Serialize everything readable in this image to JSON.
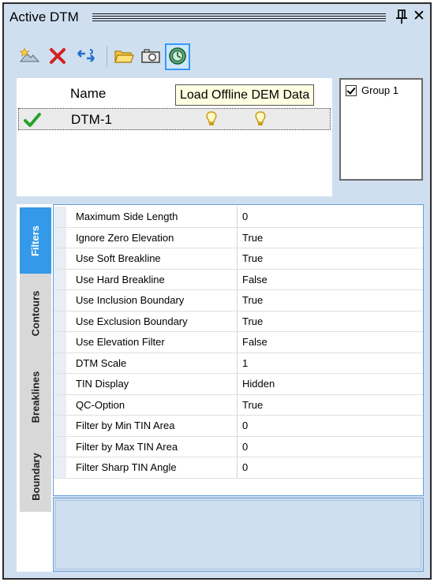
{
  "window": {
    "title": "Active DTM",
    "pin_icon": "pin-icon",
    "close_label": "✕"
  },
  "toolbar": {
    "buttons": [
      {
        "name": "new-dtm-icon"
      },
      {
        "name": "delete-icon"
      },
      {
        "name": "refresh-icon"
      },
      {
        "name": "open-folder-icon"
      },
      {
        "name": "camera-icon"
      },
      {
        "name": "globe-icon",
        "active": true
      }
    ],
    "tooltip": "Load Offline DEM Data"
  },
  "dtm_list": {
    "column_name": "Name",
    "rows": [
      {
        "name": "DTM-1",
        "checked": true
      }
    ]
  },
  "groups": {
    "items": [
      {
        "label": "Group 1",
        "checked": true
      }
    ]
  },
  "side_tabs": [
    "Filters",
    "Contours",
    "Breaklines",
    "Boundary"
  ],
  "active_tab": "Filters",
  "properties": [
    {
      "key": "Maximum Side Length",
      "value": "0"
    },
    {
      "key": "Ignore Zero Elevation",
      "value": "True"
    },
    {
      "key": "Use Soft Breakline",
      "value": "True"
    },
    {
      "key": "Use Hard Breakline",
      "value": "False"
    },
    {
      "key": "Use Inclusion Boundary",
      "value": "True"
    },
    {
      "key": "Use Exclusion Boundary",
      "value": "True"
    },
    {
      "key": "Use Elevation Filter",
      "value": "False"
    },
    {
      "key": "DTM Scale",
      "value": "1"
    },
    {
      "key": "TIN Display",
      "value": "Hidden"
    },
    {
      "key": "QC-Option",
      "value": "True"
    },
    {
      "key": "Filter by Min TIN Area",
      "value": "0"
    },
    {
      "key": "Filter by Max TIN Area",
      "value": "0"
    },
    {
      "key": "Filter Sharp TIN Angle",
      "value": "0"
    }
  ],
  "colors": {
    "panel_bg": "#cfdff0",
    "tab_active": "#3399e8",
    "accent_border": "#3399ff"
  }
}
